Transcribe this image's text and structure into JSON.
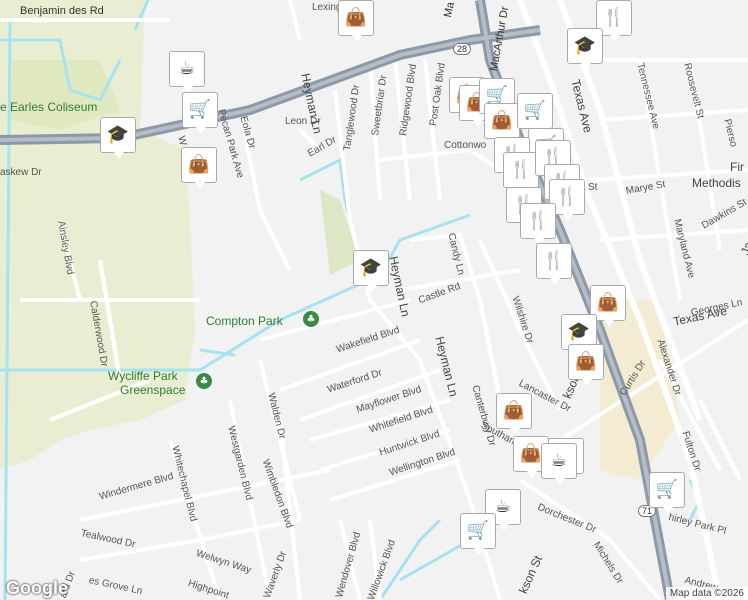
{
  "map": {
    "colors": {
      "background": "#f2f2f2",
      "road": "#ffffff",
      "highway": "#8d99a8",
      "water": "#a6e2ef",
      "park": "#e5ebc7"
    },
    "places": {
      "coliseum": "e Earles Coliseum",
      "compton_park": "Compton Park",
      "wycliffe_park_line1": "Wycliffe Park",
      "wycliffe_park_line2": "Greenspace",
      "methodist_line1": "Fir",
      "methodist_line2": "Methodis"
    },
    "streets": {
      "benjamin": "Benjamin      des Rd",
      "lexing": "Lexing",
      "macarthur": "MacArthur Dr",
      "ma": "Ma",
      "heyman_top": "Heyman Ln",
      "heyman_mid": "Heyman Ln",
      "heyman_low": "Heyman Ln",
      "tanglewood": "Tanglewood Dr",
      "sweetbriar": "Sweetbriar Dr",
      "ridgewood": "Ridgewood Blvd",
      "post_oak": "Post Oak Blvd",
      "leon": "Leon Dr",
      "eola": "Eola Dr",
      "pecan_park": "Pecan Park Ave",
      "earl": "Earl Dr",
      "cottonwo": "Cottonwo",
      "texas_ave": "Texas Ave",
      "texas_ave_e": "Texas Ave",
      "roosevelt": "Roosevelt St",
      "tennessee": "Tennessee Ave",
      "piers": "Pierso",
      "marye": "Marye St",
      "dawkins": "Dawkins St",
      "maryland": "Maryland Ave",
      "ja": "Ja",
      "georges": "Georges Ln",
      "st": "St",
      "askew": "askew Dr",
      "ainsley": "Ainsley Blvd",
      "calderwood": "Calderwood Dr",
      "wy_blvd": "W         e Blvd",
      "candy": "Candy Ln",
      "castle": "Castle Rd",
      "wilshire": "Wilshire Dr",
      "wakefield": "Wakefield Blvd",
      "waterford": "Waterford Dr",
      "mayflower": "Mayflower Blvd",
      "whitefield": "Whitefield Blvd",
      "huntwick": "Huntwick Blvd",
      "wellington": "Wellington Blvd",
      "canterbury": "Canterbury Dr",
      "lancaster": "Lancaster Dr",
      "southam": "Southam",
      "jackson": "kson St",
      "jackson_low": "kson St",
      "curtis": "Curtis Dr",
      "alexander": "Alexander Dr",
      "fulton": "Fulton Dr",
      "shirley": "hirley Park Pl",
      "dorchester": "Dorchester Dr",
      "michels": "Michels Dr",
      "andrew": "Andrew",
      "walden": "Walden Dr",
      "westgarden": "Westgarden Blvd",
      "whitechapel": "Whitechapel Blvd",
      "wimbledon": "Wimbledon Blvd",
      "windermere": "Windermere Blvd",
      "tealwood": "Tealwood Dr",
      "welwyn": "Welwyn Way",
      "highpoint": "Highpoint",
      "waverly": "Waverly Dr",
      "wendover": "Wendover Blvd",
      "willowick": "Willowick Blvd",
      "es_grove": "es Grove Ln",
      "ard": "ard Dr"
    },
    "shields": {
      "route_28": "28",
      "route_71": "71"
    },
    "google_logo": "Google",
    "credit": "Map data ©2026"
  },
  "pins": [
    {
      "icon": "restaurant-icon"
    },
    {
      "icon": "shopping-bag-icon"
    },
    {
      "icon": "school-icon"
    },
    {
      "icon": "coffee-icon"
    },
    {
      "icon": "shopping-cart-icon"
    },
    {
      "icon": "school-icon"
    },
    {
      "icon": "shopping-bag-icon"
    },
    {
      "icon": "shopping-bag-icon"
    },
    {
      "icon": "shopping-bag-icon"
    },
    {
      "icon": "shopping-cart-icon"
    },
    {
      "icon": "shopping-bag-icon"
    },
    {
      "icon": "shopping-cart-icon"
    },
    {
      "icon": "shopping-cart-icon"
    },
    {
      "icon": "restaurant-icon"
    },
    {
      "icon": "restaurant-icon"
    },
    {
      "icon": "restaurant-icon"
    },
    {
      "icon": "restaurant-icon"
    },
    {
      "icon": "restaurant-icon"
    },
    {
      "icon": "restaurant-icon"
    },
    {
      "icon": "restaurant-icon"
    },
    {
      "icon": "restaurant-icon"
    },
    {
      "icon": "school-icon"
    },
    {
      "icon": "shopping-bag-icon"
    },
    {
      "icon": "school-icon"
    },
    {
      "icon": "shopping-bag-icon"
    },
    {
      "icon": "shopping-bag-icon"
    },
    {
      "icon": "shopping-bag-icon"
    },
    {
      "icon": "coffee-icon"
    },
    {
      "icon": "coffee-icon"
    },
    {
      "icon": "shopping-cart-icon"
    },
    {
      "icon": "coffee-icon"
    },
    {
      "icon": "shopping-cart-icon"
    }
  ]
}
